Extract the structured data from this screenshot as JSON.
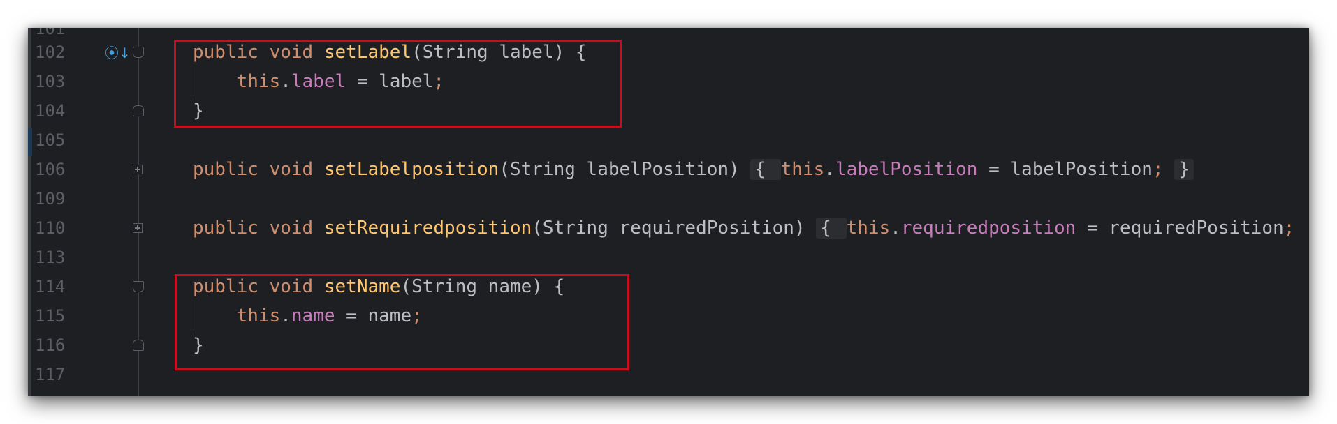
{
  "editor": {
    "lines": [
      {
        "num": "101",
        "tokens": []
      },
      {
        "num": "102",
        "tokens": [
          {
            "t": "public ",
            "c": "kw"
          },
          {
            "t": "void ",
            "c": "kw"
          },
          {
            "t": "setLabel",
            "c": "fn"
          },
          {
            "t": "(String label) {",
            "c": "ty"
          }
        ]
      },
      {
        "num": "103",
        "tokens": [
          {
            "t": "    "
          },
          {
            "t": "this",
            "c": "kw"
          },
          {
            "t": "."
          },
          {
            "t": "label",
            "c": "pr"
          },
          {
            "t": " = label"
          },
          {
            "t": ";",
            "c": "semi"
          }
        ]
      },
      {
        "num": "104",
        "tokens": [
          {
            "t": "}"
          }
        ]
      },
      {
        "num": "105",
        "tokens": []
      },
      {
        "num": "106",
        "tokens": [
          {
            "t": "public ",
            "c": "kw"
          },
          {
            "t": "void ",
            "c": "kw"
          },
          {
            "t": "setLabelposition",
            "c": "fn"
          },
          {
            "t": "(String labelPosition) "
          },
          {
            "t": "{ ",
            "box": true
          },
          {
            "t": "this",
            "c": "kw"
          },
          {
            "t": "."
          },
          {
            "t": "labelPosition",
            "c": "pr"
          },
          {
            "t": " = labelPosition"
          },
          {
            "t": ";",
            "c": "semi"
          },
          {
            "t": " "
          },
          {
            "t": "}",
            "box": true
          }
        ]
      },
      {
        "num": "109",
        "tokens": []
      },
      {
        "num": "110",
        "tokens": [
          {
            "t": "public ",
            "c": "kw"
          },
          {
            "t": "void ",
            "c": "kw"
          },
          {
            "t": "setRequiredposition",
            "c": "fn"
          },
          {
            "t": "(String requiredPosition) "
          },
          {
            "t": "{ ",
            "box": true
          },
          {
            "t": "this",
            "c": "kw"
          },
          {
            "t": "."
          },
          {
            "t": "requiredposition",
            "c": "pr"
          },
          {
            "t": " = requiredPosition"
          },
          {
            "t": ";",
            "c": "semi"
          }
        ]
      },
      {
        "num": "113",
        "tokens": []
      },
      {
        "num": "114",
        "tokens": [
          {
            "t": "public ",
            "c": "kw"
          },
          {
            "t": "void ",
            "c": "kw"
          },
          {
            "t": "setName",
            "c": "fn"
          },
          {
            "t": "(String name) {"
          }
        ]
      },
      {
        "num": "115",
        "tokens": [
          {
            "t": "    "
          },
          {
            "t": "this",
            "c": "kw"
          },
          {
            "t": "."
          },
          {
            "t": "name",
            "c": "pr"
          },
          {
            "t": " = name"
          },
          {
            "t": ";",
            "c": "semi"
          }
        ]
      },
      {
        "num": "116",
        "tokens": [
          {
            "t": "}"
          }
        ]
      },
      {
        "num": "117",
        "tokens": []
      }
    ]
  },
  "colors": {
    "background": "#1e1f22",
    "keyword": "#cf8e6d",
    "function": "#ffc66d",
    "property": "#c77dbb",
    "text": "#bcbec4",
    "line_number": "#5b5e64",
    "highlight_box": "#c50f1f"
  },
  "icons": {
    "line_102": "implementation-gutter-icon"
  }
}
